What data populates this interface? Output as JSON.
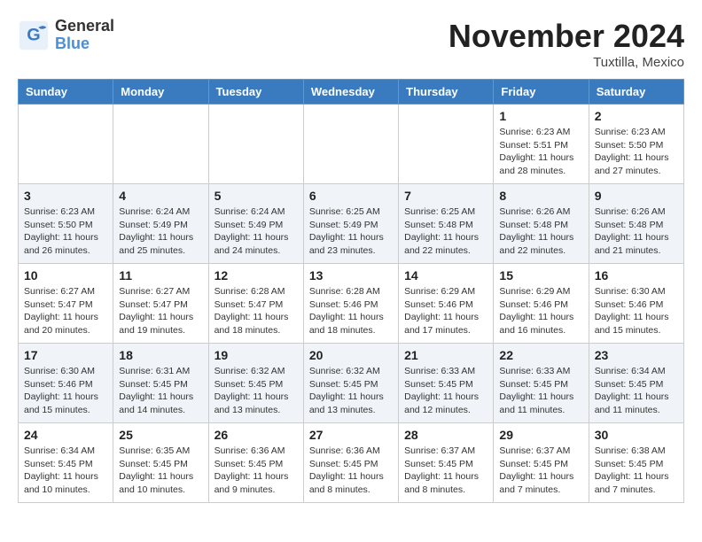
{
  "logo": {
    "general": "General",
    "blue": "Blue"
  },
  "header": {
    "month": "November 2024",
    "location": "Tuxtilla, Mexico"
  },
  "weekdays": [
    "Sunday",
    "Monday",
    "Tuesday",
    "Wednesday",
    "Thursday",
    "Friday",
    "Saturday"
  ],
  "weeks": [
    [
      {
        "day": "",
        "info": ""
      },
      {
        "day": "",
        "info": ""
      },
      {
        "day": "",
        "info": ""
      },
      {
        "day": "",
        "info": ""
      },
      {
        "day": "",
        "info": ""
      },
      {
        "day": "1",
        "info": "Sunrise: 6:23 AM\nSunset: 5:51 PM\nDaylight: 11 hours and 28 minutes."
      },
      {
        "day": "2",
        "info": "Sunrise: 6:23 AM\nSunset: 5:50 PM\nDaylight: 11 hours and 27 minutes."
      }
    ],
    [
      {
        "day": "3",
        "info": "Sunrise: 6:23 AM\nSunset: 5:50 PM\nDaylight: 11 hours and 26 minutes."
      },
      {
        "day": "4",
        "info": "Sunrise: 6:24 AM\nSunset: 5:49 PM\nDaylight: 11 hours and 25 minutes."
      },
      {
        "day": "5",
        "info": "Sunrise: 6:24 AM\nSunset: 5:49 PM\nDaylight: 11 hours and 24 minutes."
      },
      {
        "day": "6",
        "info": "Sunrise: 6:25 AM\nSunset: 5:49 PM\nDaylight: 11 hours and 23 minutes."
      },
      {
        "day": "7",
        "info": "Sunrise: 6:25 AM\nSunset: 5:48 PM\nDaylight: 11 hours and 22 minutes."
      },
      {
        "day": "8",
        "info": "Sunrise: 6:26 AM\nSunset: 5:48 PM\nDaylight: 11 hours and 22 minutes."
      },
      {
        "day": "9",
        "info": "Sunrise: 6:26 AM\nSunset: 5:48 PM\nDaylight: 11 hours and 21 minutes."
      }
    ],
    [
      {
        "day": "10",
        "info": "Sunrise: 6:27 AM\nSunset: 5:47 PM\nDaylight: 11 hours and 20 minutes."
      },
      {
        "day": "11",
        "info": "Sunrise: 6:27 AM\nSunset: 5:47 PM\nDaylight: 11 hours and 19 minutes."
      },
      {
        "day": "12",
        "info": "Sunrise: 6:28 AM\nSunset: 5:47 PM\nDaylight: 11 hours and 18 minutes."
      },
      {
        "day": "13",
        "info": "Sunrise: 6:28 AM\nSunset: 5:46 PM\nDaylight: 11 hours and 18 minutes."
      },
      {
        "day": "14",
        "info": "Sunrise: 6:29 AM\nSunset: 5:46 PM\nDaylight: 11 hours and 17 minutes."
      },
      {
        "day": "15",
        "info": "Sunrise: 6:29 AM\nSunset: 5:46 PM\nDaylight: 11 hours and 16 minutes."
      },
      {
        "day": "16",
        "info": "Sunrise: 6:30 AM\nSunset: 5:46 PM\nDaylight: 11 hours and 15 minutes."
      }
    ],
    [
      {
        "day": "17",
        "info": "Sunrise: 6:30 AM\nSunset: 5:46 PM\nDaylight: 11 hours and 15 minutes."
      },
      {
        "day": "18",
        "info": "Sunrise: 6:31 AM\nSunset: 5:45 PM\nDaylight: 11 hours and 14 minutes."
      },
      {
        "day": "19",
        "info": "Sunrise: 6:32 AM\nSunset: 5:45 PM\nDaylight: 11 hours and 13 minutes."
      },
      {
        "day": "20",
        "info": "Sunrise: 6:32 AM\nSunset: 5:45 PM\nDaylight: 11 hours and 13 minutes."
      },
      {
        "day": "21",
        "info": "Sunrise: 6:33 AM\nSunset: 5:45 PM\nDaylight: 11 hours and 12 minutes."
      },
      {
        "day": "22",
        "info": "Sunrise: 6:33 AM\nSunset: 5:45 PM\nDaylight: 11 hours and 11 minutes."
      },
      {
        "day": "23",
        "info": "Sunrise: 6:34 AM\nSunset: 5:45 PM\nDaylight: 11 hours and 11 minutes."
      }
    ],
    [
      {
        "day": "24",
        "info": "Sunrise: 6:34 AM\nSunset: 5:45 PM\nDaylight: 11 hours and 10 minutes."
      },
      {
        "day": "25",
        "info": "Sunrise: 6:35 AM\nSunset: 5:45 PM\nDaylight: 11 hours and 10 minutes."
      },
      {
        "day": "26",
        "info": "Sunrise: 6:36 AM\nSunset: 5:45 PM\nDaylight: 11 hours and 9 minutes."
      },
      {
        "day": "27",
        "info": "Sunrise: 6:36 AM\nSunset: 5:45 PM\nDaylight: 11 hours and 8 minutes."
      },
      {
        "day": "28",
        "info": "Sunrise: 6:37 AM\nSunset: 5:45 PM\nDaylight: 11 hours and 8 minutes."
      },
      {
        "day": "29",
        "info": "Sunrise: 6:37 AM\nSunset: 5:45 PM\nDaylight: 11 hours and 7 minutes."
      },
      {
        "day": "30",
        "info": "Sunrise: 6:38 AM\nSunset: 5:45 PM\nDaylight: 11 hours and 7 minutes."
      }
    ]
  ]
}
